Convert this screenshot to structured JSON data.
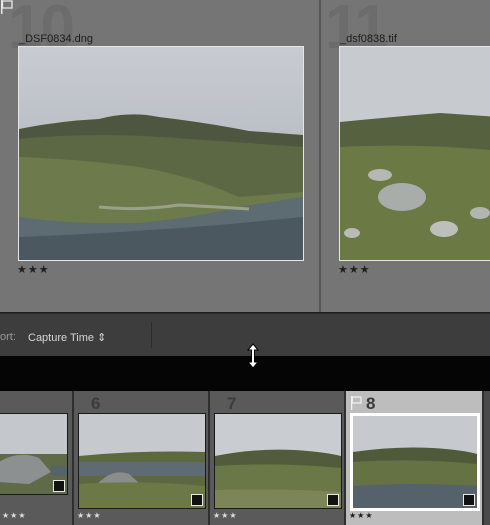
{
  "grid": {
    "cells": [
      {
        "number": "10",
        "filename": "_DSF0834.dng",
        "stars": "★★★"
      },
      {
        "number": "11",
        "filename": "_dsf0838.tif",
        "stars": "★★★"
      }
    ]
  },
  "toolbar": {
    "sort_label": "ort:",
    "sort_value": "Capture Time ⇕"
  },
  "filmstrip": {
    "cells": [
      {
        "number": "",
        "stars": "★★★"
      },
      {
        "number": "6",
        "stars": "★★★"
      },
      {
        "number": "7",
        "stars": "★★★"
      },
      {
        "number": "8",
        "stars": "★★★"
      }
    ]
  },
  "colors": {
    "grid_bg": "#757575",
    "toolbar_bg": "#3d3d3d",
    "selected_cell": "#bdbdbd"
  }
}
